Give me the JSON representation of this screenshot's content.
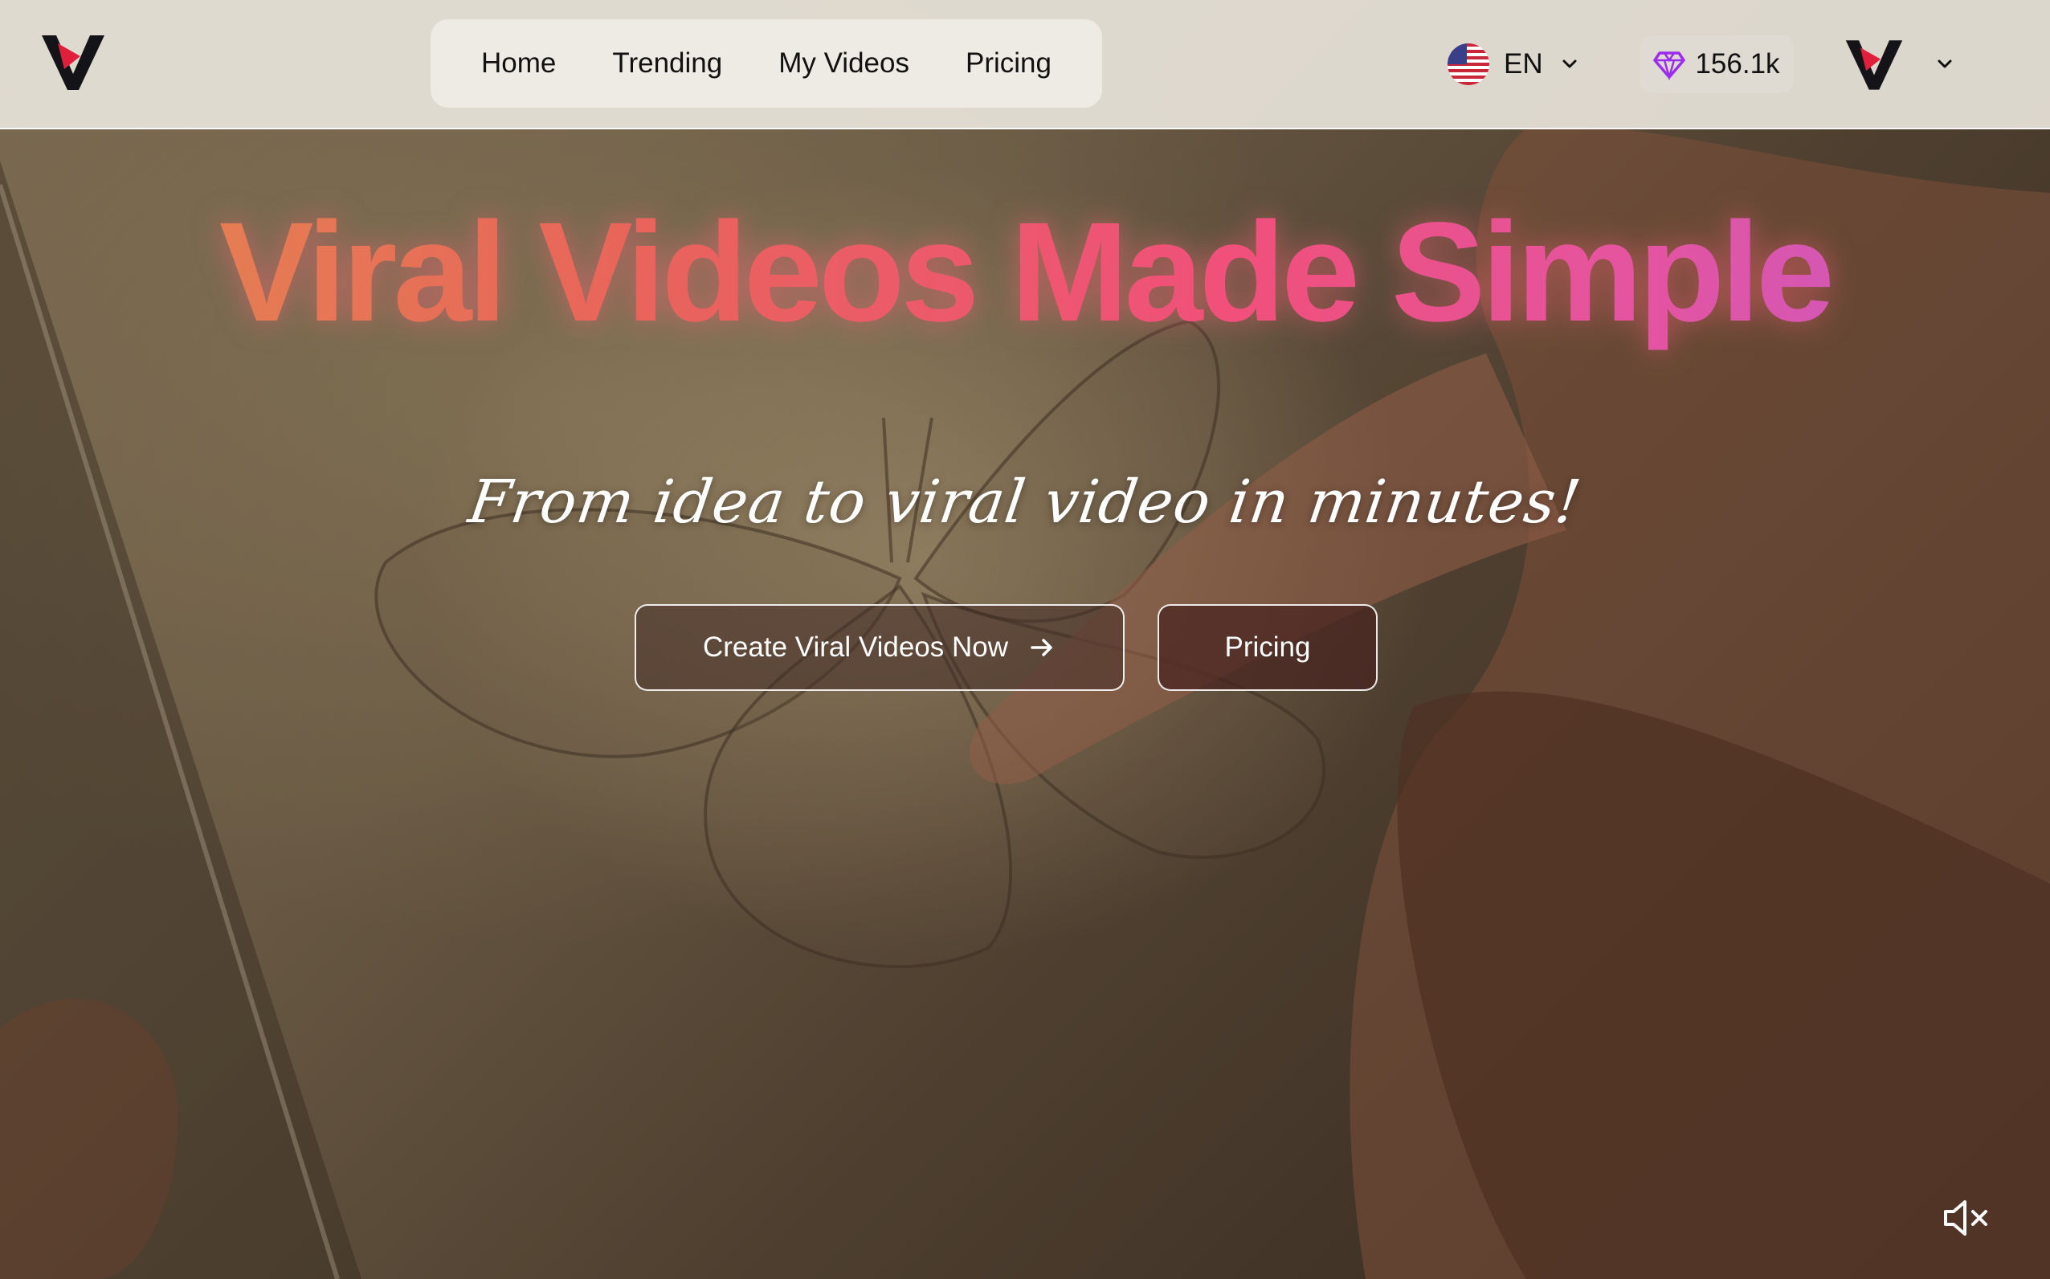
{
  "header": {
    "nav": [
      {
        "label": "Home"
      },
      {
        "label": "Trending"
      },
      {
        "label": "My Videos"
      },
      {
        "label": "Pricing"
      }
    ],
    "language": {
      "code": "EN",
      "flag": "us-flag-icon"
    },
    "credits": {
      "value": "156.1k",
      "icon": "diamond-icon"
    },
    "account": {
      "avatar": "avatar-logo",
      "menu_icon": "chevron-down-icon"
    }
  },
  "hero": {
    "title": "Viral Videos Made Simple",
    "subtitle": "From idea to viral video in minutes!",
    "primary_button": "Create Viral Videos Now",
    "secondary_button": "Pricing"
  },
  "controls": {
    "mute_icon": "volume-muted-icon"
  },
  "colors": {
    "title_gradient": [
      "#e38a4f",
      "#e8655a",
      "#f0507a",
      "#e454a0",
      "#c35bc8"
    ],
    "gem": "#9b2cf0",
    "logo_red": "#e0203a"
  }
}
